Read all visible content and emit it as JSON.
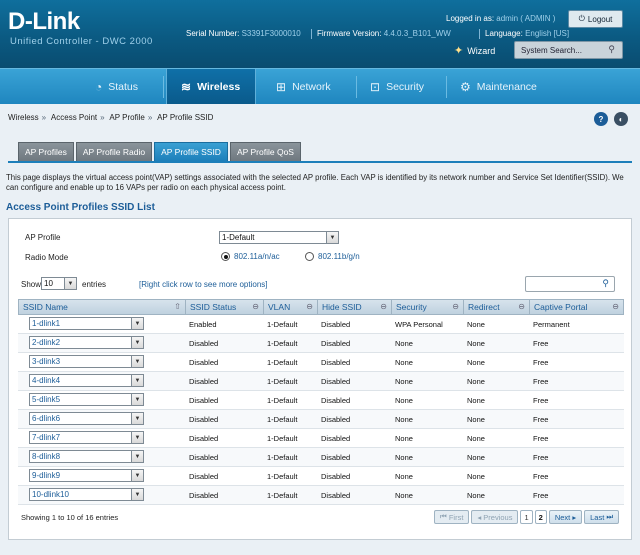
{
  "header": {
    "brand": "D-Link",
    "product": "Unified Controller - DWC 2000",
    "serial_label": "Serial Number:",
    "serial_value": "S3391F3000010",
    "firmware_label": "Firmware Version:",
    "firmware_value": "4.4.0.3_B101_WW",
    "language_label": "Language:",
    "language_value": "English [US]",
    "logged_label": "Logged in as:",
    "logged_value": "admin ( ADMIN )",
    "logout_label": "Logout",
    "wizard_label": "Wizard",
    "search_placeholder": "System Search..."
  },
  "nav": {
    "status": "Status",
    "wireless": "Wireless",
    "network": "Network",
    "security": "Security",
    "maintenance": "Maintenance",
    "active": "Wireless"
  },
  "breadcrumb": [
    "Wireless",
    "Access Point",
    "AP Profile",
    "AP Profile SSID"
  ],
  "subtabs": [
    "AP Profiles",
    "AP Profile Radio",
    "AP Profile SSID",
    "AP Profile QoS"
  ],
  "active_subtab": "AP Profile SSID",
  "description": "This page displays the virtual access point(VAP) settings associated with the selected AP profile. Each VAP is identified by its network number and Service Set Identifier(SSID). We can configure and enable up to 16 VAPs per radio on each physical access point.",
  "section_title": "Access Point Profiles SSID List",
  "form": {
    "ap_profile_label": "AP Profile",
    "ap_profile_value": "1-Default",
    "radio_mode_label": "Radio Mode",
    "radio_options": [
      "802.11a/n/ac",
      "802.11b/g/n"
    ],
    "radio_selected": "802.11a/n/ac"
  },
  "table_controls": {
    "show_label": "Show",
    "show_value": "10",
    "entries_label": "entries",
    "hint": "[Right click row to see more options]"
  },
  "columns": [
    "SSID Name",
    "SSID Status",
    "VLAN",
    "Hide SSID",
    "Security",
    "Redirect",
    "Captive Portal"
  ],
  "rows": [
    {
      "ssid": "1-dlink1",
      "status": "Enabled",
      "vlan": "1-Default",
      "hide": "Disabled",
      "security": "WPA Personal",
      "redirect": "None",
      "portal": "Permanent"
    },
    {
      "ssid": "2-dlink2",
      "status": "Disabled",
      "vlan": "1-Default",
      "hide": "Disabled",
      "security": "None",
      "redirect": "None",
      "portal": "Free"
    },
    {
      "ssid": "3-dlink3",
      "status": "Disabled",
      "vlan": "1-Default",
      "hide": "Disabled",
      "security": "None",
      "redirect": "None",
      "portal": "Free"
    },
    {
      "ssid": "4-dlink4",
      "status": "Disabled",
      "vlan": "1-Default",
      "hide": "Disabled",
      "security": "None",
      "redirect": "None",
      "portal": "Free"
    },
    {
      "ssid": "5-dlink5",
      "status": "Disabled",
      "vlan": "1-Default",
      "hide": "Disabled",
      "security": "None",
      "redirect": "None",
      "portal": "Free"
    },
    {
      "ssid": "6-dlink6",
      "status": "Disabled",
      "vlan": "1-Default",
      "hide": "Disabled",
      "security": "None",
      "redirect": "None",
      "portal": "Free"
    },
    {
      "ssid": "7-dlink7",
      "status": "Disabled",
      "vlan": "1-Default",
      "hide": "Disabled",
      "security": "None",
      "redirect": "None",
      "portal": "Free"
    },
    {
      "ssid": "8-dlink8",
      "status": "Disabled",
      "vlan": "1-Default",
      "hide": "Disabled",
      "security": "None",
      "redirect": "None",
      "portal": "Free"
    },
    {
      "ssid": "9-dlink9",
      "status": "Disabled",
      "vlan": "1-Default",
      "hide": "Disabled",
      "security": "None",
      "redirect": "None",
      "portal": "Free"
    },
    {
      "ssid": "10-dlink10",
      "status": "Disabled",
      "vlan": "1-Default",
      "hide": "Disabled",
      "security": "None",
      "redirect": "None",
      "portal": "Free"
    }
  ],
  "footer": {
    "showing": "Showing 1 to 10 of 16 entries",
    "first": "First",
    "previous": "Previous",
    "pages": [
      "1",
      "2"
    ],
    "current_page": "2",
    "next": "Next",
    "last": "Last"
  },
  "icons": {
    "status": "status-gauge-icon",
    "wireless": "wifi-icon",
    "network": "network-icon",
    "security": "lock-icon",
    "maintenance": "gears-icon",
    "help": "help-icon",
    "logout": "logout-icon"
  },
  "colors": {
    "header": "#0b5a82",
    "nav": "#2a93c9",
    "active_tab": "#1d7fba",
    "link": "#1c5d98"
  }
}
